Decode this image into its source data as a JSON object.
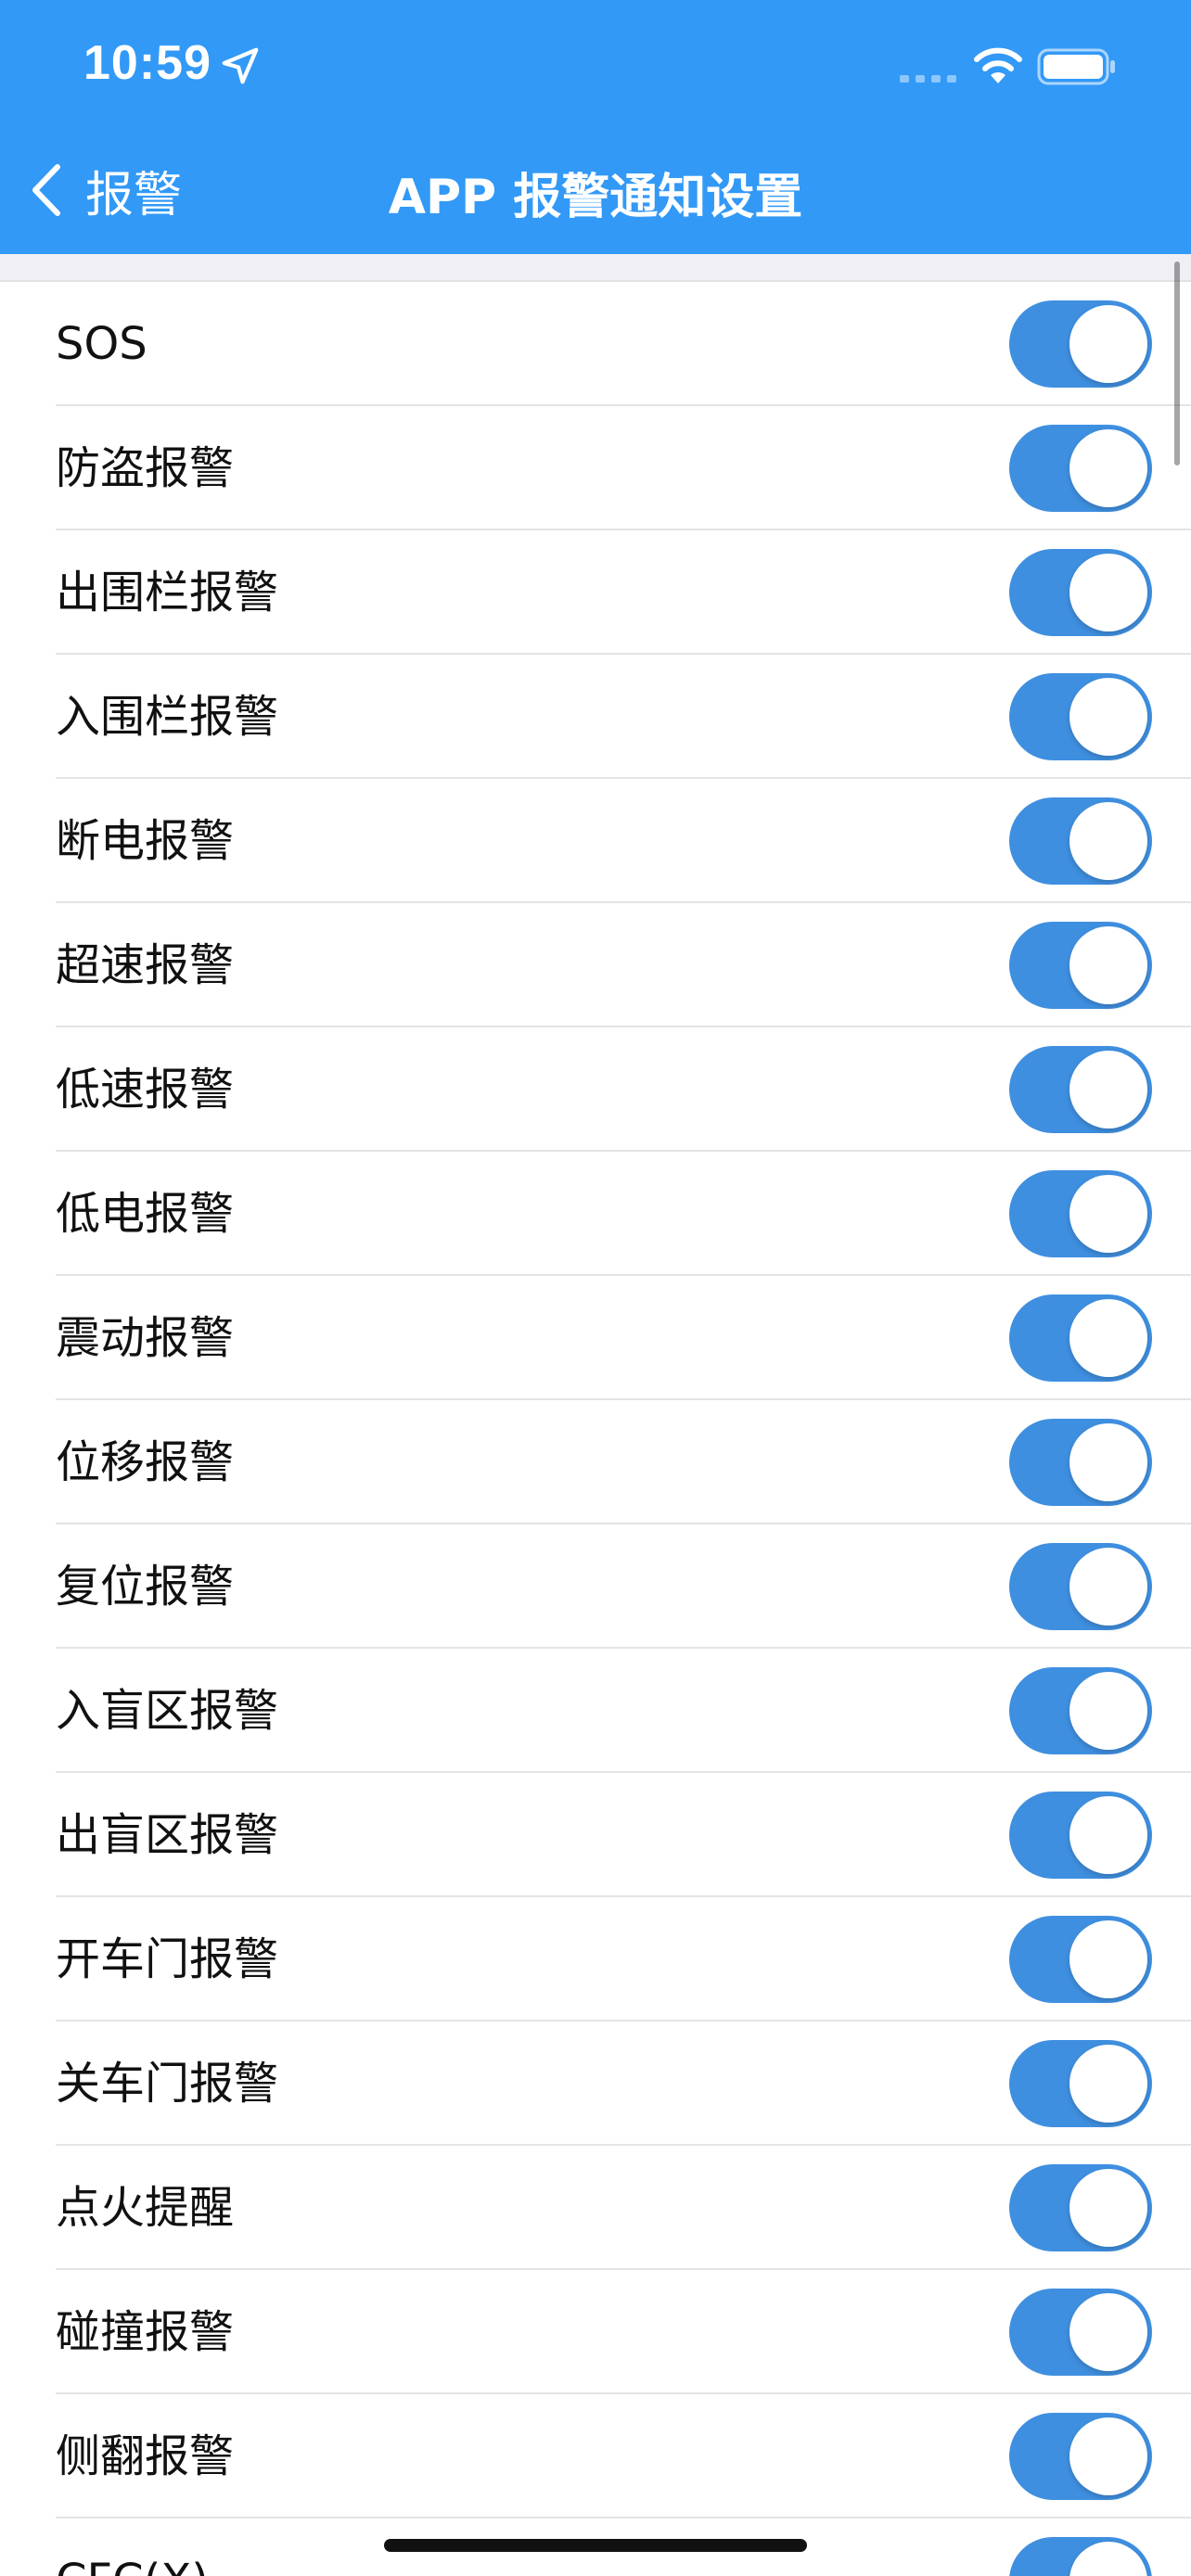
{
  "status_bar": {
    "time": "10:59",
    "icons": [
      "location-arrow-icon",
      "cellular-signal-icon",
      "wifi-icon",
      "battery-icon"
    ]
  },
  "nav": {
    "back_label": "报警",
    "title": "APP 报警通知设置"
  },
  "colors": {
    "header": "#3299f7",
    "toggle_on": "#3f8fe0",
    "separator": "#e4e4e8"
  },
  "alarms": [
    {
      "label": "SOS",
      "enabled": true
    },
    {
      "label": "防盗报警",
      "enabled": true
    },
    {
      "label": "出围栏报警",
      "enabled": true
    },
    {
      "label": "入围栏报警",
      "enabled": true
    },
    {
      "label": "断电报警",
      "enabled": true
    },
    {
      "label": "超速报警",
      "enabled": true
    },
    {
      "label": "低速报警",
      "enabled": true
    },
    {
      "label": "低电报警",
      "enabled": true
    },
    {
      "label": "震动报警",
      "enabled": true
    },
    {
      "label": "位移报警",
      "enabled": true
    },
    {
      "label": "复位报警",
      "enabled": true
    },
    {
      "label": "入盲区报警",
      "enabled": true
    },
    {
      "label": "出盲区报警",
      "enabled": true
    },
    {
      "label": "开车门报警",
      "enabled": true
    },
    {
      "label": "关车门报警",
      "enabled": true
    },
    {
      "label": "点火提醒",
      "enabled": true
    },
    {
      "label": "碰撞报警",
      "enabled": true
    },
    {
      "label": "侧翻报警",
      "enabled": true
    },
    {
      "label": "CFC(X)",
      "enabled": true
    }
  ]
}
